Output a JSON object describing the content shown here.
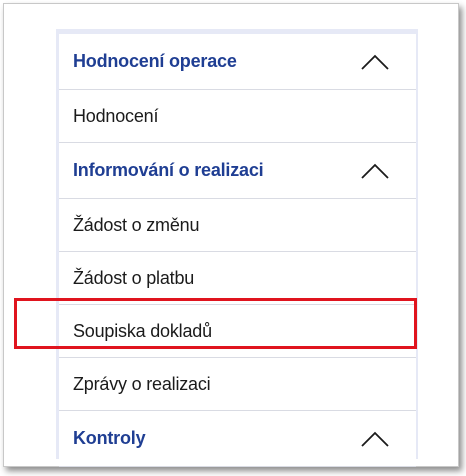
{
  "menu": {
    "sections": [
      {
        "title": "Hodnocení operace",
        "items": [
          "Hodnocení"
        ]
      },
      {
        "title": "Informování o realizaci",
        "items": [
          "Žádost o změnu",
          "Žádost o platbu",
          "Soupiska dokladů",
          "Zprávy o realizaci"
        ]
      },
      {
        "title": "Kontroly",
        "items": []
      }
    ],
    "highlighted_item": "Soupiska dokladů",
    "colors": {
      "section_title": "#1f3e93",
      "highlight_border": "#e0141e",
      "panel_background": "#e6e9f6"
    },
    "chevron_icon": "chevron-up-icon"
  }
}
